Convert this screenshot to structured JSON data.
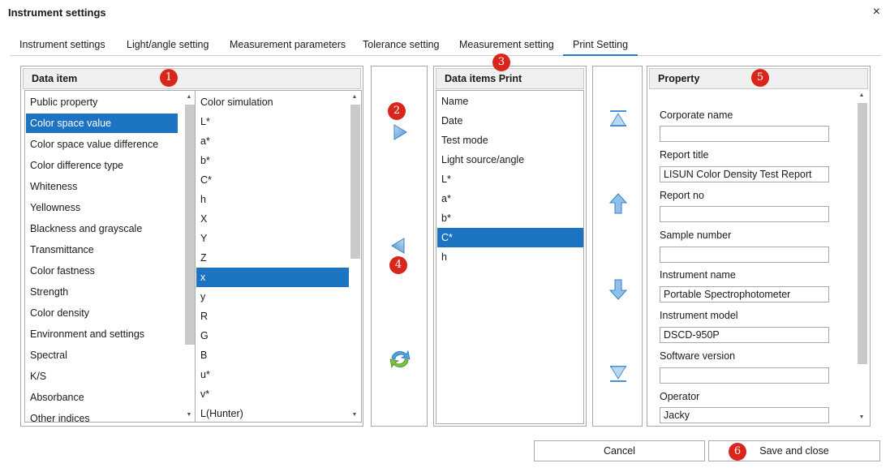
{
  "window": {
    "title": "Instrument settings",
    "close_glyph": "×"
  },
  "tabs": [
    {
      "label": "Instrument settings"
    },
    {
      "label": "Light/angle setting"
    },
    {
      "label": "Measurement parameters"
    },
    {
      "label": "Tolerance setting"
    },
    {
      "label": "Measurement setting"
    },
    {
      "label": "Print Setting",
      "active": true
    }
  ],
  "data_item": {
    "header": "Data item",
    "categories": [
      "Public property",
      "Color space value",
      "Color space value difference",
      "Color difference type",
      "Whiteness",
      "Yellowness",
      "Blackness and grayscale",
      "Transmittance",
      "Color fastness",
      "Strength",
      "Color density",
      "Environment and settings",
      "Spectral",
      "K/S",
      "Absorbance",
      "Other indices"
    ],
    "selected_category": "Color space value",
    "values": [
      "Color simulation",
      "L*",
      "a*",
      "b*",
      "C*",
      "h",
      "X",
      "Y",
      "Z",
      "x",
      "y",
      "R",
      "G",
      "B",
      "u*",
      "v*",
      "L(Hunter)"
    ],
    "selected_value": "x"
  },
  "transfer": {
    "add_icon": "arrow-right-icon",
    "remove_icon": "arrow-left-icon",
    "refresh_icon": "refresh-icon"
  },
  "print_items": {
    "header": "Data items Print",
    "items": [
      "Name",
      "Date",
      "Test mode",
      "Light source/angle",
      "L*",
      "a*",
      "b*",
      "C*",
      "h"
    ],
    "selected": "C*"
  },
  "order": {
    "top_icon": "move-to-top-icon",
    "up_icon": "move-up-icon",
    "down_icon": "move-down-icon",
    "bottom_icon": "move-to-bottom-icon"
  },
  "property": {
    "header": "Property",
    "fields": [
      {
        "label": "Corporate name",
        "value": ""
      },
      {
        "label": "Report title",
        "value": "LISUN Color Density Test Report"
      },
      {
        "label": "Report no",
        "value": ""
      },
      {
        "label": "Sample number",
        "value": ""
      },
      {
        "label": "Instrument name",
        "value": "Portable Spectrophotometer"
      },
      {
        "label": "Instrument model",
        "value": "DSCD-950P"
      },
      {
        "label": "Software version",
        "value": ""
      },
      {
        "label": "Operator",
        "value": "Jacky"
      }
    ]
  },
  "buttons": {
    "cancel": "Cancel",
    "save": "Save and close"
  },
  "badges": [
    "1",
    "2",
    "3",
    "4",
    "5",
    "6"
  ],
  "colors": {
    "selection": "#1b73c2",
    "badge": "#d9261c",
    "tab_underline": "#2b78c5",
    "icon_blue": "#5b9bd5"
  }
}
